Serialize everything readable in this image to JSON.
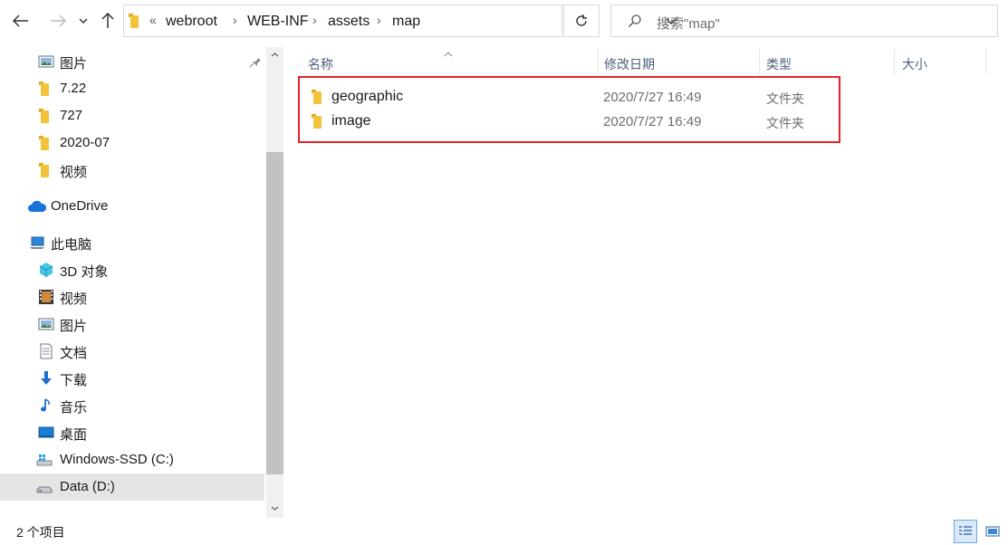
{
  "toolbar": {
    "back_icon": "arrow-left-icon",
    "forward_icon": "arrow-right-icon",
    "recent_icon": "chevron-down-icon",
    "up_icon": "arrow-up-icon",
    "refresh_icon": "refresh-icon"
  },
  "address": {
    "overflow": "«",
    "crumbs": [
      "webroot",
      "WEB-INF",
      "assets",
      "map"
    ]
  },
  "search": {
    "placeholder": "搜索\"map\""
  },
  "nav": {
    "items": [
      {
        "label": "图片",
        "icon": "pictures-icon"
      },
      {
        "label": "7.22",
        "icon": "folder-icon"
      },
      {
        "label": "727",
        "icon": "folder-icon"
      },
      {
        "label": "2020-07",
        "icon": "folder-icon"
      },
      {
        "label": "视频",
        "icon": "folder-icon"
      },
      {
        "label": "OneDrive",
        "icon": "cloud-icon"
      },
      {
        "label": "此电脑",
        "icon": "computer-icon"
      },
      {
        "label": "3D 对象",
        "icon": "cube-icon"
      },
      {
        "label": "视频",
        "icon": "video-icon"
      },
      {
        "label": "图片",
        "icon": "pictures-icon"
      },
      {
        "label": "文档",
        "icon": "document-icon"
      },
      {
        "label": "下载",
        "icon": "download-icon"
      },
      {
        "label": "音乐",
        "icon": "music-icon"
      },
      {
        "label": "桌面",
        "icon": "desktop-icon"
      },
      {
        "label": "Windows-SSD (C:)",
        "icon": "drive-windows-icon"
      },
      {
        "label": "Data (D:)",
        "icon": "drive-icon"
      }
    ]
  },
  "columns": {
    "name": "名称",
    "modified": "修改日期",
    "type": "类型",
    "size": "大小"
  },
  "files": [
    {
      "name": "geographic",
      "modified": "2020/7/27 16:49",
      "type": "文件夹"
    },
    {
      "name": "image",
      "modified": "2020/7/27 16:49",
      "type": "文件夹"
    }
  ],
  "status": {
    "count_text": "2 个项目"
  },
  "colors": {
    "highlight": "#e5232b",
    "folder": "#f2c23a",
    "selected_nav": "#e5e5e5"
  }
}
